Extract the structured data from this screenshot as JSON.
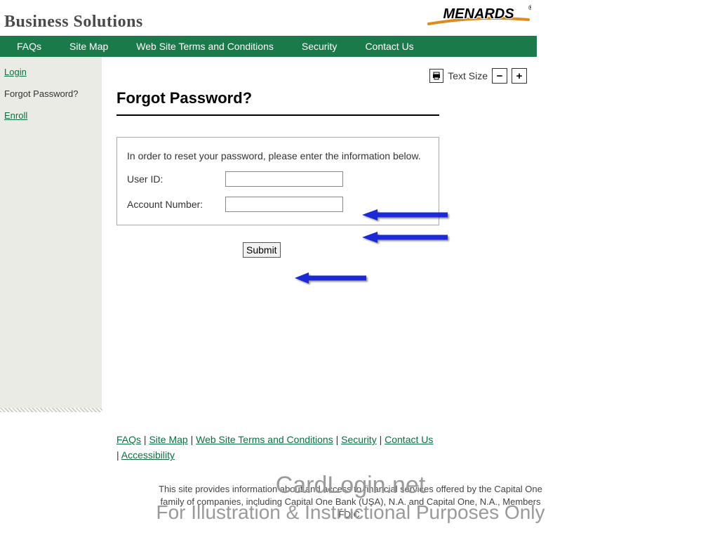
{
  "header": {
    "site_title": "Business Solutions",
    "logo_text": "MENARDS"
  },
  "nav": {
    "items": [
      "FAQs",
      "Site Map",
      "Web Site Terms and Conditions",
      "Security",
      "Contact Us"
    ]
  },
  "sidebar": {
    "login": "Login",
    "forgot": "Forgot Password?",
    "enroll": "Enroll"
  },
  "toolbar": {
    "text_size_label": "Text Size",
    "minus": "−",
    "plus": "+"
  },
  "main": {
    "heading": "Forgot Password?",
    "intro": "In order to reset your password, please enter the information below.",
    "user_id_label": "User ID:",
    "account_label": "Account Number:",
    "submit_label": "Submit"
  },
  "footer": {
    "faqs": "FAQs",
    "sitemap": "Site Map",
    "terms": "Web Site Terms and Conditions",
    "security": "Security",
    "contact": "Contact Us",
    "accessibility": "Accessibility",
    "sep": " | "
  },
  "disclaimer": "This site provides information about and access to financial services offered by the Capital One family of companies, including Capital One Bank (USA), N.A. and Capital One, N.A., Members FDIC.",
  "watermark": {
    "line1": "CardLogin.net",
    "line2": "For Illustration & Instructional Purposes Only"
  }
}
